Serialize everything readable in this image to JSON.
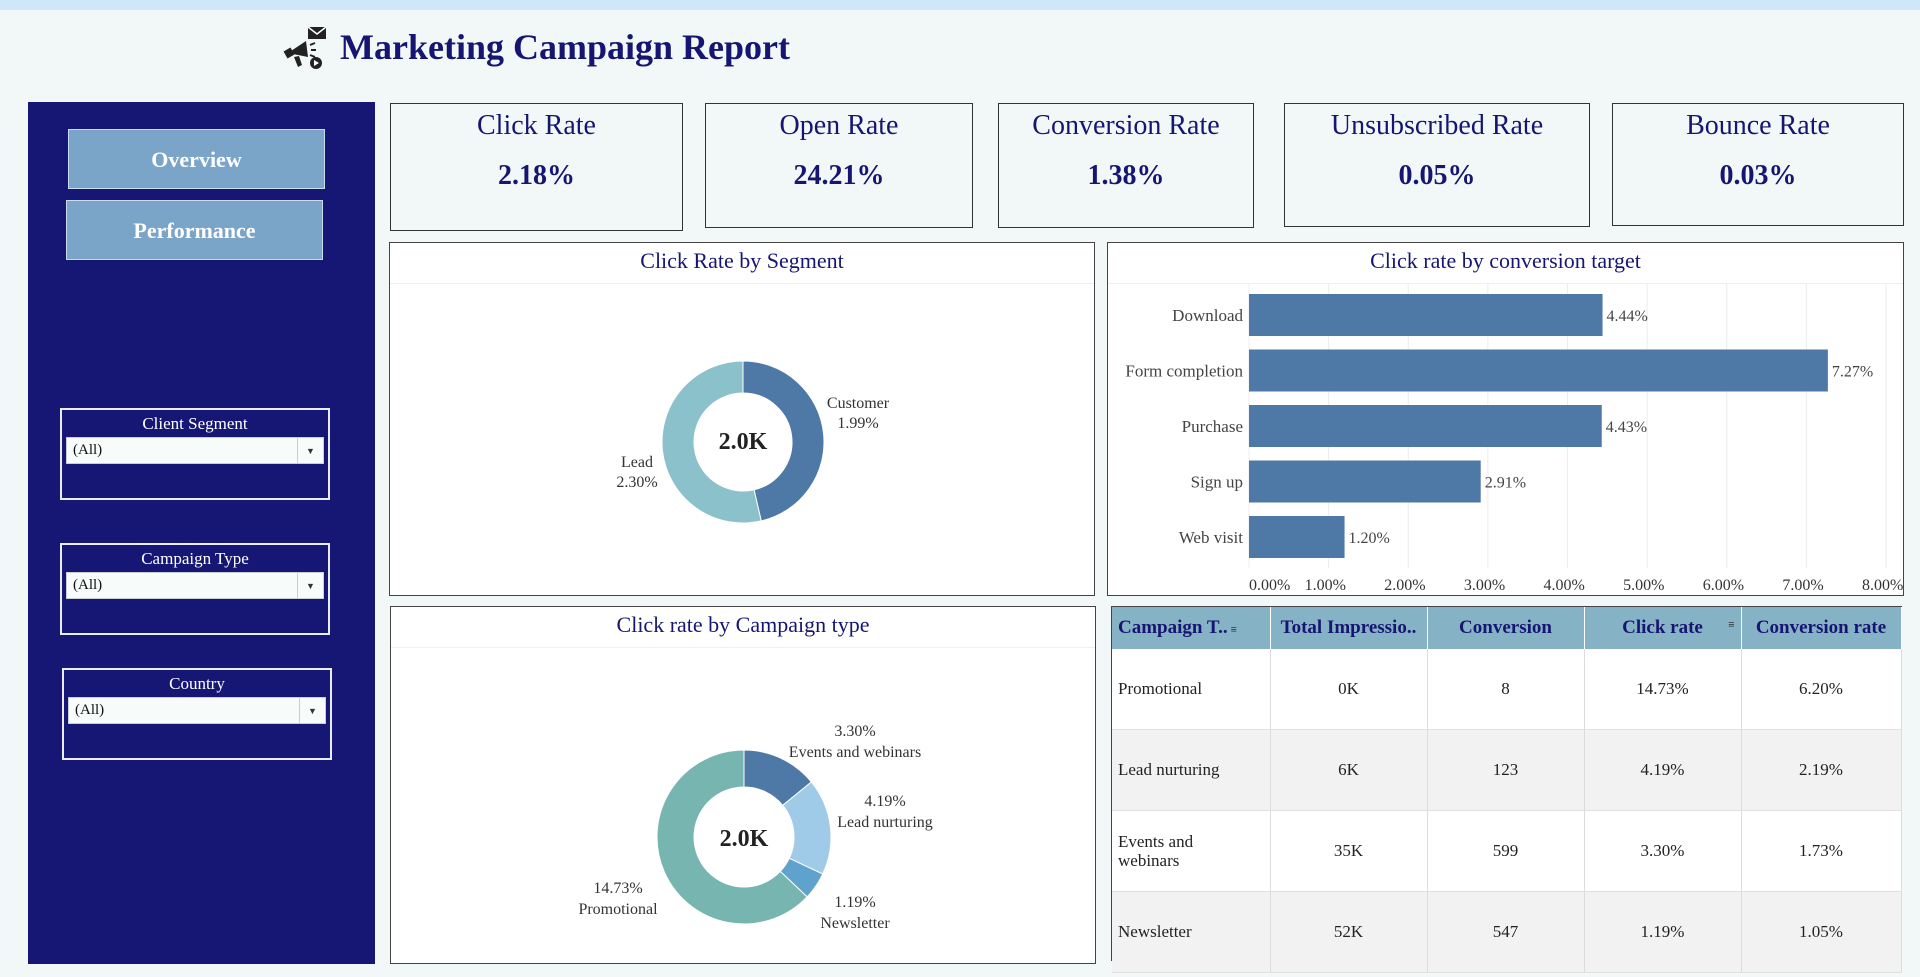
{
  "title": "Marketing Campaign Report",
  "nav": {
    "overview": "Overview",
    "performance": "Performance"
  },
  "filters": [
    {
      "label": "Client Segment",
      "value": "(All)"
    },
    {
      "label": "Campaign Type",
      "value": "(All)"
    },
    {
      "label": "Country",
      "value": "(All)"
    }
  ],
  "kpis": [
    {
      "label": "Click Rate",
      "value": "2.18%"
    },
    {
      "label": "Open Rate",
      "value": "24.21%"
    },
    {
      "label": "Conversion Rate",
      "value": "1.38%"
    },
    {
      "label": "Unsubscribed Rate",
      "value": "0.05%"
    },
    {
      "label": "Bounce Rate",
      "value": "0.03%"
    }
  ],
  "colors": {
    "navy": "#161672",
    "steel": "#4e79a7",
    "teal": "#8bc1cb",
    "lightblue": "#a0cbe8",
    "blue": "#5fa2ce",
    "green": "#76b5b0"
  },
  "chart_data": [
    {
      "type": "pie",
      "title": "Click Rate by Segment",
      "center_label": "2.0K",
      "slices": [
        {
          "name": "Customer",
          "value": 1.99,
          "label": "1.99%",
          "color": "#4e79a7"
        },
        {
          "name": "Lead",
          "value": 2.3,
          "label": "2.30%",
          "color": "#8bc1cb"
        }
      ]
    },
    {
      "type": "bar",
      "title": "Click rate by conversion target",
      "orientation": "horizontal",
      "categories": [
        "Download",
        "Form completion",
        "Purchase",
        "Sign up",
        "Web visit"
      ],
      "values": [
        4.44,
        7.27,
        4.43,
        2.91,
        1.2
      ],
      "value_labels": [
        "4.44%",
        "7.27%",
        "4.43%",
        "2.91%",
        "1.20%"
      ],
      "xlim": [
        0,
        8
      ],
      "xticks": [
        "0.00%",
        "1.00%",
        "2.00%",
        "3.00%",
        "4.00%",
        "5.00%",
        "6.00%",
        "7.00%",
        "8.00%"
      ],
      "color": "#4e79a7",
      "grid": true
    },
    {
      "type": "pie",
      "title": "Click rate by Campaign type",
      "center_label": "2.0K",
      "slices": [
        {
          "name": "Events and webinars",
          "value": 3.3,
          "label": "3.30%",
          "color": "#4e79a7"
        },
        {
          "name": "Lead nurturing",
          "value": 4.19,
          "label": "4.19%",
          "color": "#a0cbe8"
        },
        {
          "name": "Newsletter",
          "value": 1.19,
          "label": "1.19%",
          "color": "#5fa2ce"
        },
        {
          "name": "Promotional",
          "value": 14.73,
          "label": "14.73%",
          "color": "#76b5b0"
        }
      ]
    },
    {
      "type": "table",
      "columns": [
        "Campaign T..",
        "Total Impressio..",
        "Conversion",
        "Click rate",
        "Conversion rate"
      ],
      "rows": [
        [
          "Promotional",
          "0K",
          "8",
          "14.73%",
          "6.20%"
        ],
        [
          "Lead nurturing",
          "6K",
          "123",
          "4.19%",
          "2.19%"
        ],
        [
          "Events and webinars",
          "35K",
          "599",
          "3.30%",
          "1.73%"
        ],
        [
          "Newsletter",
          "52K",
          "547",
          "1.19%",
          "1.05%"
        ]
      ]
    }
  ]
}
